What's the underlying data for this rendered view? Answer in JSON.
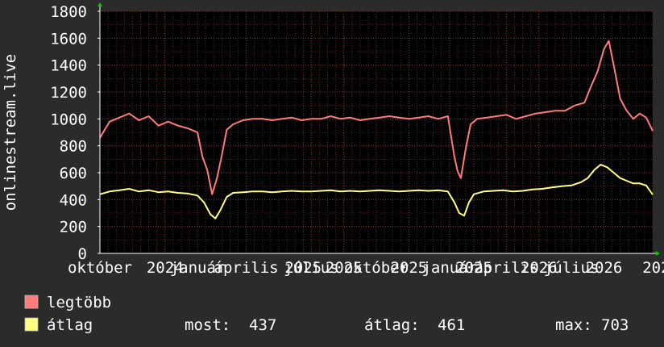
{
  "chart_data": {
    "type": "line",
    "ylabel": "onlinestream.live",
    "ylim": [
      0,
      1800
    ],
    "yticks": [
      0,
      200,
      400,
      600,
      800,
      1000,
      1200,
      1400,
      1600,
      1800
    ],
    "xlim": [
      0,
      34
    ],
    "x_ticks": [
      {
        "x": 0.0,
        "label": "október"
      },
      {
        "x": 4.0,
        "label": "2024"
      },
      {
        "x": 6.0,
        "label": "január"
      },
      {
        "x": 9.0,
        "label": "április"
      },
      {
        "x": 12.5,
        "label": "2025"
      },
      {
        "x": 13.0,
        "label": "július"
      },
      {
        "x": 15.0,
        "label": "2025"
      },
      {
        "x": 17.0,
        "label": "október"
      },
      {
        "x": 19.0,
        "label": "2025"
      },
      {
        "x": 21.5,
        "label": "január"
      },
      {
        "x": 23.0,
        "label": "2025"
      },
      {
        "x": 25.0,
        "label": "április"
      },
      {
        "x": 27.0,
        "label": "2026"
      },
      {
        "x": 29.0,
        "label": "július"
      },
      {
        "x": 31.0,
        "label": "2026"
      },
      {
        "x": 34.5,
        "label": "2026"
      }
    ],
    "grid": true,
    "series": [
      {
        "name": "legtöbb",
        "color": "#ff7b7b",
        "points": [
          [
            0.0,
            860
          ],
          [
            0.6,
            980
          ],
          [
            1.2,
            1010
          ],
          [
            1.8,
            1040
          ],
          [
            2.4,
            990
          ],
          [
            3.0,
            1020
          ],
          [
            3.6,
            950
          ],
          [
            4.2,
            980
          ],
          [
            4.8,
            950
          ],
          [
            5.4,
            930
          ],
          [
            6.0,
            900
          ],
          [
            6.3,
            720
          ],
          [
            6.6,
            620
          ],
          [
            6.9,
            440
          ],
          [
            7.2,
            560
          ],
          [
            7.5,
            730
          ],
          [
            7.8,
            920
          ],
          [
            8.2,
            960
          ],
          [
            8.8,
            990
          ],
          [
            9.4,
            1000
          ],
          [
            10.0,
            1000
          ],
          [
            10.6,
            990
          ],
          [
            11.2,
            1000
          ],
          [
            11.8,
            1010
          ],
          [
            12.4,
            990
          ],
          [
            13.0,
            1000
          ],
          [
            13.6,
            1000
          ],
          [
            14.2,
            1020
          ],
          [
            14.8,
            1000
          ],
          [
            15.4,
            1010
          ],
          [
            16.0,
            990
          ],
          [
            16.6,
            1000
          ],
          [
            17.2,
            1010
          ],
          [
            17.8,
            1020
          ],
          [
            18.4,
            1010
          ],
          [
            19.0,
            1000
          ],
          [
            19.6,
            1010
          ],
          [
            20.2,
            1020
          ],
          [
            20.8,
            1000
          ],
          [
            21.4,
            1020
          ],
          [
            21.8,
            720
          ],
          [
            22.0,
            610
          ],
          [
            22.2,
            560
          ],
          [
            22.5,
            780
          ],
          [
            22.8,
            960
          ],
          [
            23.2,
            1000
          ],
          [
            23.8,
            1010
          ],
          [
            24.4,
            1020
          ],
          [
            25.0,
            1030
          ],
          [
            25.6,
            1000
          ],
          [
            26.2,
            1020
          ],
          [
            26.8,
            1040
          ],
          [
            27.4,
            1050
          ],
          [
            28.0,
            1060
          ],
          [
            28.6,
            1060
          ],
          [
            29.2,
            1100
          ],
          [
            29.8,
            1120
          ],
          [
            30.2,
            1240
          ],
          [
            30.6,
            1350
          ],
          [
            31.0,
            1520
          ],
          [
            31.3,
            1580
          ],
          [
            31.6,
            1400
          ],
          [
            32.0,
            1150
          ],
          [
            32.4,
            1060
          ],
          [
            32.8,
            1000
          ],
          [
            33.2,
            1040
          ],
          [
            33.6,
            1010
          ],
          [
            34.0,
            910
          ]
        ]
      },
      {
        "name": "átlag",
        "color": "#ffff80",
        "points": [
          [
            0.0,
            440
          ],
          [
            0.6,
            460
          ],
          [
            1.2,
            470
          ],
          [
            1.8,
            480
          ],
          [
            2.4,
            460
          ],
          [
            3.0,
            470
          ],
          [
            3.6,
            455
          ],
          [
            4.2,
            460
          ],
          [
            4.8,
            450
          ],
          [
            5.4,
            445
          ],
          [
            6.0,
            430
          ],
          [
            6.4,
            380
          ],
          [
            6.8,
            290
          ],
          [
            7.1,
            260
          ],
          [
            7.4,
            320
          ],
          [
            7.8,
            420
          ],
          [
            8.2,
            450
          ],
          [
            8.8,
            455
          ],
          [
            9.4,
            460
          ],
          [
            10.0,
            460
          ],
          [
            10.6,
            455
          ],
          [
            11.2,
            460
          ],
          [
            11.8,
            465
          ],
          [
            12.4,
            460
          ],
          [
            13.0,
            460
          ],
          [
            13.6,
            465
          ],
          [
            14.2,
            470
          ],
          [
            14.8,
            460
          ],
          [
            15.4,
            465
          ],
          [
            16.0,
            460
          ],
          [
            16.6,
            465
          ],
          [
            17.2,
            470
          ],
          [
            17.8,
            465
          ],
          [
            18.4,
            460
          ],
          [
            19.0,
            465
          ],
          [
            19.6,
            470
          ],
          [
            20.2,
            465
          ],
          [
            20.8,
            470
          ],
          [
            21.4,
            460
          ],
          [
            21.8,
            380
          ],
          [
            22.1,
            300
          ],
          [
            22.4,
            280
          ],
          [
            22.7,
            380
          ],
          [
            23.0,
            440
          ],
          [
            23.6,
            460
          ],
          [
            24.2,
            465
          ],
          [
            24.8,
            470
          ],
          [
            25.4,
            460
          ],
          [
            26.0,
            465
          ],
          [
            26.6,
            475
          ],
          [
            27.2,
            480
          ],
          [
            27.8,
            490
          ],
          [
            28.4,
            500
          ],
          [
            29.0,
            505
          ],
          [
            29.6,
            530
          ],
          [
            30.0,
            560
          ],
          [
            30.4,
            620
          ],
          [
            30.8,
            660
          ],
          [
            31.2,
            640
          ],
          [
            31.6,
            600
          ],
          [
            32.0,
            560
          ],
          [
            32.4,
            540
          ],
          [
            32.8,
            520
          ],
          [
            33.2,
            520
          ],
          [
            33.6,
            505
          ],
          [
            34.0,
            437
          ]
        ]
      }
    ],
    "legend": {
      "placement": "bottom-left",
      "items": [
        {
          "label": "legtöbb",
          "color": "#ff7b7b"
        },
        {
          "label": "átlag",
          "color": "#ffff80"
        }
      ]
    },
    "stats": {
      "most_label": "most:",
      "most": "437",
      "atlag_label": "átlag:",
      "atlag": "461",
      "max_label": "max:",
      "max": "703"
    }
  }
}
